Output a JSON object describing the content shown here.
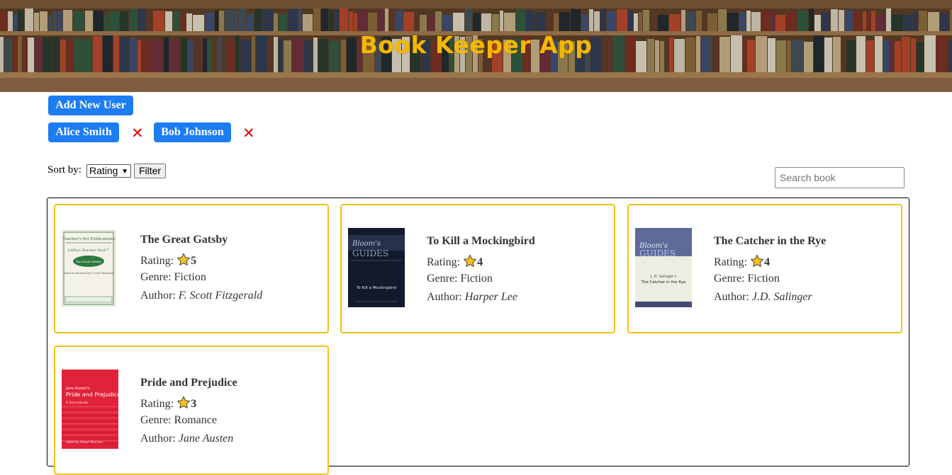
{
  "header": {
    "title": "Book Keeper App"
  },
  "users": {
    "add_label": "Add New User",
    "list": [
      {
        "name": "Alice Smith",
        "remove": "✕"
      },
      {
        "name": "Bob Johnson",
        "remove": "✕"
      }
    ]
  },
  "controls": {
    "sort_label": "Sort by:",
    "sort_value": "Rating",
    "filter_label": "Filter",
    "search_placeholder": "Search book"
  },
  "labels": {
    "rating": "Rating:",
    "genre": "Genre:",
    "author": "Author:"
  },
  "books": [
    {
      "title": "The Great Gatsby",
      "rating": 5,
      "genre": "Fiction",
      "author": "F. Scott Fitzgerald",
      "cover": {
        "publisher": "Teacher's Pet Publications",
        "series": "LitPlan Teacher Pack™",
        "book": "The Great Gatsby",
        "byline": "based on the book by F. Scott Fitzgerald"
      }
    },
    {
      "title": "To Kill a Mockingbird",
      "rating": 4,
      "genre": "Fiction",
      "author": "Harper Lee",
      "cover": {
        "brand": "Bloom's",
        "brand2": "GUIDES",
        "book": "To Kill a Mockingbird"
      }
    },
    {
      "title": "The Catcher in the Rye",
      "rating": 4,
      "genre": "Fiction",
      "author": "J.D. Salinger",
      "cover": {
        "brand": "Bloom's",
        "brand2": "GUIDES",
        "author_line": "J. D. Salinger's",
        "book": "The Catcher in the Rye"
      }
    },
    {
      "title": "Pride and Prejudice",
      "rating": 3,
      "genre": "Romance",
      "author": "Jane Austen",
      "cover": {
        "author_line": "Jane Austen's",
        "book": "Pride and Prejudice",
        "subtitle": "A Sourcebook",
        "editor": "edited by Robert Morrison"
      }
    }
  ],
  "colors": {
    "accent": "#1d7cf2",
    "title": "#f5b800",
    "card_border": "#f2c21b",
    "remove": "#e00000",
    "star": "#f7c21e"
  }
}
